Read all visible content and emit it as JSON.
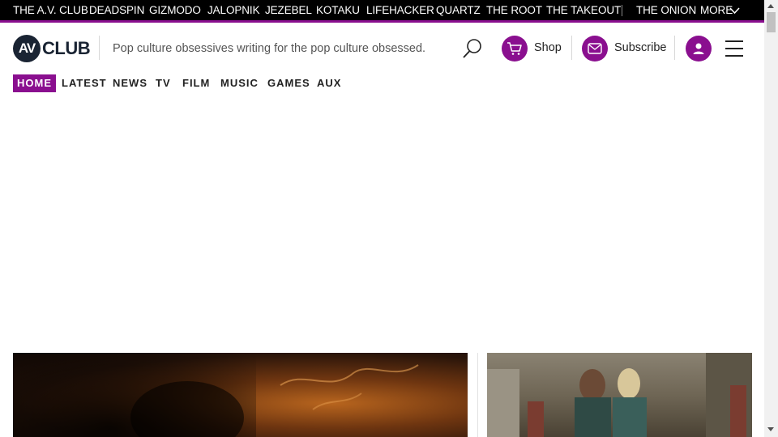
{
  "network_bar": {
    "sites": [
      "THE A.V. CLUB",
      "DEADSPIN",
      "GIZMODO",
      "JALOPNIK",
      "JEZEBEL",
      "KOTAKU",
      "LIFEHACKER",
      "QUARTZ",
      "THE ROOT",
      "THE TAKEOUT"
    ],
    "extra_site": "THE ONION",
    "more_label": "MORE"
  },
  "header": {
    "logo_av": "AV",
    "logo_club": "CLUB",
    "tagline": "Pop culture obsessives writing for the pop culture obsessed.",
    "shop_label": "Shop",
    "subscribe_label": "Subscribe"
  },
  "nav": {
    "items": [
      "HOME",
      "LATEST",
      "NEWS",
      "TV",
      "FILM",
      "MUSIC",
      "GAMES",
      "AUX"
    ],
    "active": "HOME"
  },
  "colors": {
    "accent": "#8a0f8f",
    "topbar_bg": "#000000",
    "logo": "#1a2433"
  },
  "icons": {
    "search": "search-icon",
    "shop": "cart-icon",
    "subscribe": "mail-icon",
    "account": "user-icon",
    "menu": "hamburger-icon",
    "more": "chevron-down-icon"
  }
}
